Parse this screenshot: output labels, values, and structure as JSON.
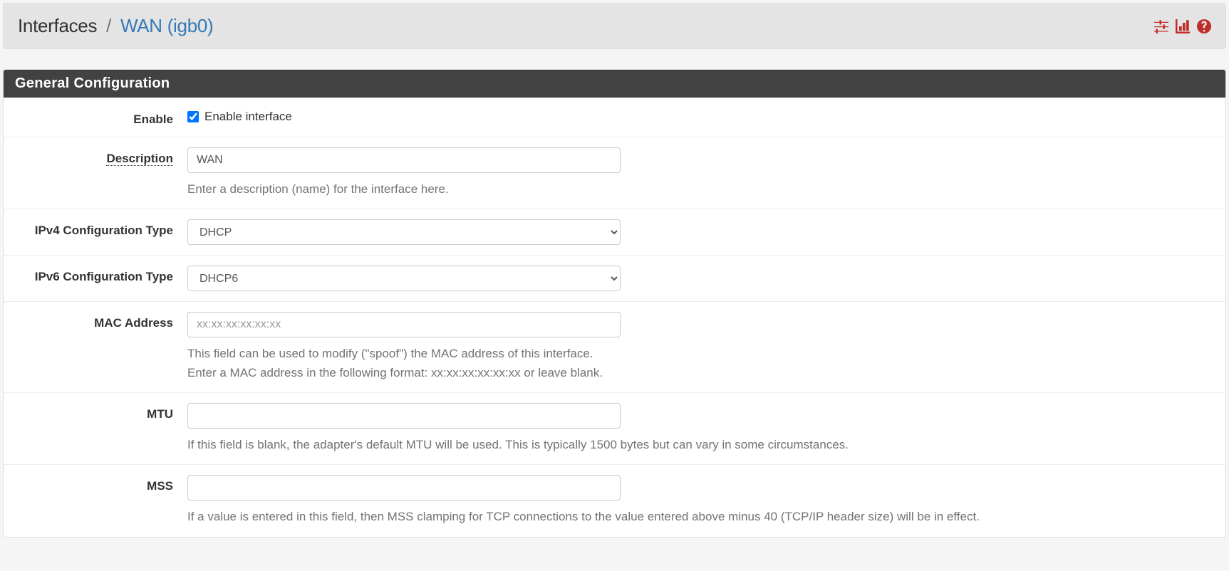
{
  "breadcrumb": {
    "section": "Interfaces",
    "separator": "/",
    "page": "WAN (igb0)"
  },
  "panel": {
    "title": "General Configuration"
  },
  "fields": {
    "enable": {
      "label": "Enable",
      "checkbox_label": "Enable interface",
      "checked": true
    },
    "description": {
      "label": "Description",
      "value": "WAN",
      "help": "Enter a description (name) for the interface here."
    },
    "ipv4conf": {
      "label": "IPv4 Configuration Type",
      "value": "DHCP"
    },
    "ipv6conf": {
      "label": "IPv6 Configuration Type",
      "value": "DHCP6"
    },
    "mac": {
      "label": "MAC Address",
      "placeholder": "xx:xx:xx:xx:xx:xx",
      "value": "",
      "help": "This field can be used to modify (\"spoof\") the MAC address of this interface.\nEnter a MAC address in the following format: xx:xx:xx:xx:xx:xx or leave blank."
    },
    "mtu": {
      "label": "MTU",
      "value": "",
      "help": "If this field is blank, the adapter's default MTU will be used. This is typically 1500 bytes but can vary in some circumstances."
    },
    "mss": {
      "label": "MSS",
      "value": "",
      "help": "If a value is entered in this field, then MSS clamping for TCP connections to the value entered above minus 40 (TCP/IP header size) will be in effect."
    }
  }
}
